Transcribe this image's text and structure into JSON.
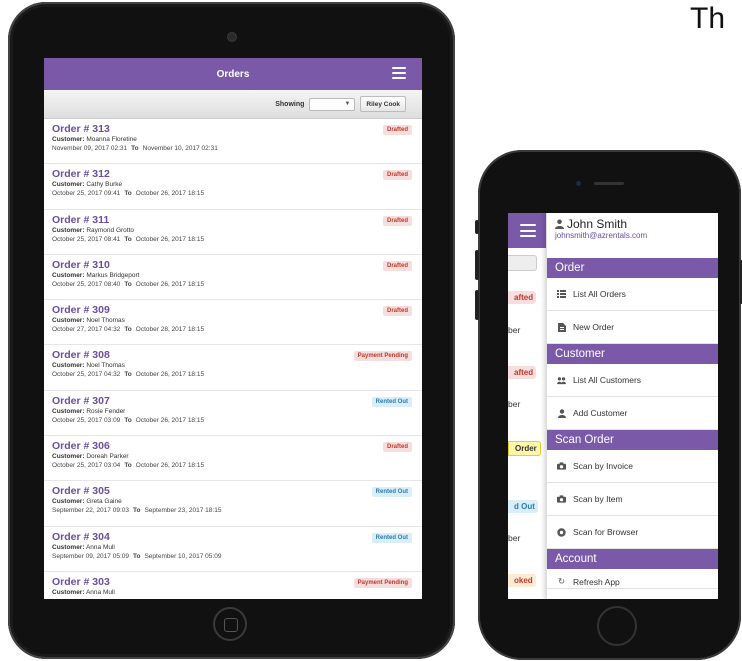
{
  "corner_text": "Th",
  "tablet": {
    "header_title": "Orders",
    "filter": {
      "showing_label": "Showing",
      "select_value": "",
      "user_button": "Riley Cook"
    },
    "orders": [
      {
        "number": "Order # 313",
        "customer_label": "Customer:",
        "customer": "Moanna Floretine",
        "from": "November 09, 2017 02:31",
        "to_label": "To",
        "to": "November 10, 2017 02:31",
        "status": "Drafted"
      },
      {
        "number": "Order # 312",
        "customer_label": "Customer:",
        "customer": "Cathy Burke",
        "from": "October 25, 2017 09:41",
        "to_label": "To",
        "to": "October 26, 2017 18:15",
        "status": "Drafted"
      },
      {
        "number": "Order # 311",
        "customer_label": "Customer:",
        "customer": "Raymond Grotto",
        "from": "October 25, 2017 08:41",
        "to_label": "To",
        "to": "October 26, 2017 18:15",
        "status": "Drafted"
      },
      {
        "number": "Order # 310",
        "customer_label": "Customer:",
        "customer": "Markus Bridgeport",
        "from": "October 25, 2017 08:40",
        "to_label": "To",
        "to": "October 26, 2017 18:15",
        "status": "Drafted"
      },
      {
        "number": "Order # 309",
        "customer_label": "Customer:",
        "customer": "Noel Thomas",
        "from": "October 27, 2017 04:32",
        "to_label": "To",
        "to": "October 28, 2017 18:15",
        "status": "Drafted"
      },
      {
        "number": "Order # 308",
        "customer_label": "Customer:",
        "customer": "Noel Thomas",
        "from": "October 25, 2017 04:32",
        "to_label": "To",
        "to": "October 26, 2017 18:15",
        "status": "Payment Pending"
      },
      {
        "number": "Order # 307",
        "customer_label": "Customer:",
        "customer": "Rosie Fender",
        "from": "October 25, 2017 03:09",
        "to_label": "To",
        "to": "October 26, 2017 18:15",
        "status": "Rented Out"
      },
      {
        "number": "Order # 306",
        "customer_label": "Customer:",
        "customer": "Doreah Parker",
        "from": "October 25, 2017 03:04",
        "to_label": "To",
        "to": "October 26, 2017 18:15",
        "status": "Drafted"
      },
      {
        "number": "Order # 305",
        "customer_label": "Customer:",
        "customer": "Greta Gaine",
        "from": "September 22, 2017 09:03",
        "to_label": "To",
        "to": "September 23, 2017 18:15",
        "status": "Rented Out"
      },
      {
        "number": "Order # 304",
        "customer_label": "Customer:",
        "customer": "Anna Mull",
        "from": "September 09, 2017 05:09",
        "to_label": "To",
        "to": "September 10, 2017 05:09",
        "status": "Rented Out"
      },
      {
        "number": "Order # 303",
        "customer_label": "Customer:",
        "customer": "Anna Mull",
        "from": "",
        "to_label": "",
        "to": "",
        "status": "Payment Pending"
      }
    ]
  },
  "phone": {
    "peeks": [
      {
        "text": "afted",
        "kind": "red"
      },
      {
        "text": "ber",
        "kind": "text"
      },
      {
        "text": "afted",
        "kind": "red"
      },
      {
        "text": "ber",
        "kind": "text"
      },
      {
        "text": "Order",
        "kind": "yellow"
      },
      {
        "text": "d Out",
        "kind": "blue"
      },
      {
        "text": "ber",
        "kind": "text"
      },
      {
        "text": "oked",
        "kind": "orange"
      }
    ],
    "user": {
      "name": "John Smith",
      "email": "johnsmith@azrentals.com"
    },
    "sections": {
      "order": {
        "title": "Order",
        "items": [
          "List All Orders",
          "New Order"
        ]
      },
      "customer": {
        "title": "Customer",
        "items": [
          "List All Customers",
          "Add Customer"
        ]
      },
      "scan": {
        "title": "Scan Order",
        "items": [
          "Scan by Invoice",
          "Scan by Item",
          "Scan for Browser"
        ]
      },
      "account": {
        "title": "Account",
        "items": [
          "Refresh App"
        ]
      }
    }
  },
  "colors": {
    "accent": "#7a5aa8",
    "drafted": "#c0392b",
    "rented": "#2a7cb0"
  }
}
